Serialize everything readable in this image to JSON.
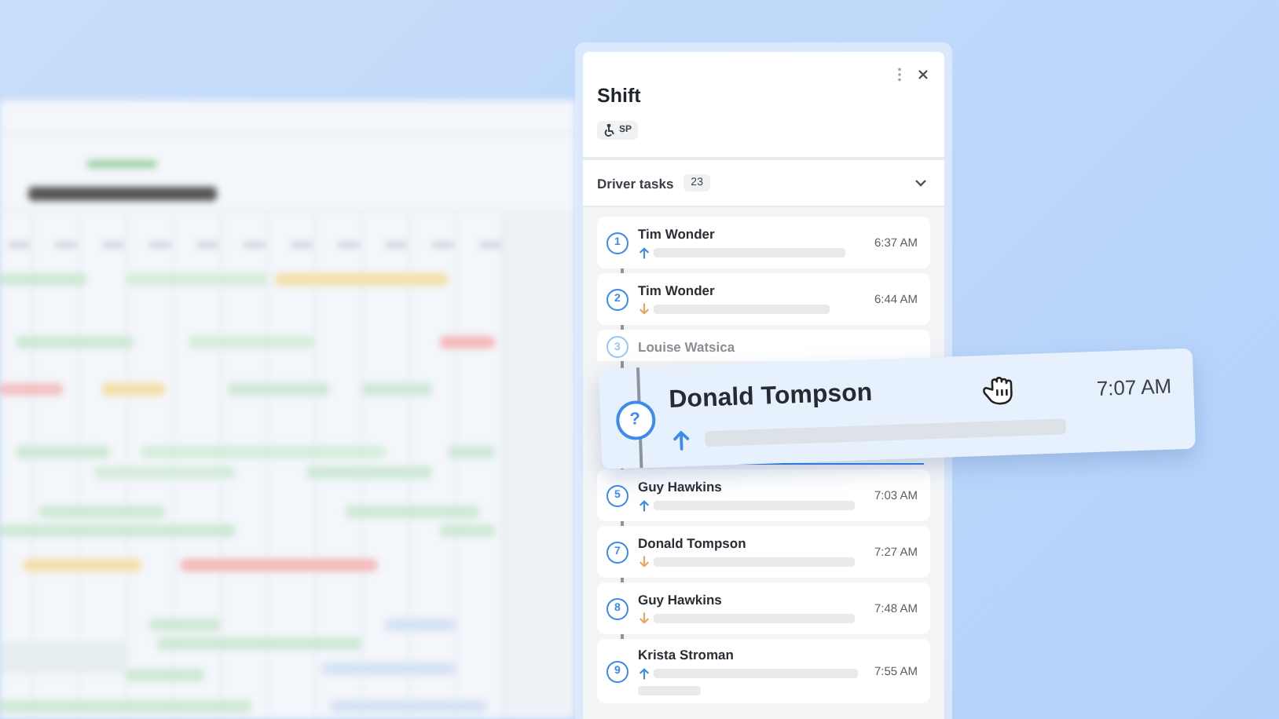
{
  "panel": {
    "title": "Shift",
    "badge": "SP"
  },
  "section": {
    "label": "Driver tasks",
    "count": "23",
    "expanded": true
  },
  "tasks": [
    {
      "number": "1",
      "name": "Tim Wonder",
      "time": "6:37 AM",
      "kind": "pickup"
    },
    {
      "number": "2",
      "name": "Tim Wonder",
      "time": "6:44 AM",
      "kind": "dropoff"
    },
    {
      "number": "3",
      "name": "Louise Watsica",
      "kind": "covered"
    },
    {
      "number": "5",
      "name": "Guy Hawkins",
      "time": "7:03 AM",
      "kind": "pickup"
    },
    {
      "number": "7",
      "name": "Donald Tompson",
      "time": "7:27 AM",
      "kind": "dropoff"
    },
    {
      "number": "8",
      "name": "Guy Hawkins",
      "time": "7:48 AM",
      "kind": "dropoff"
    },
    {
      "number": "9",
      "name": "Krista Stroman",
      "time": "7:55 AM",
      "kind": "pickup"
    }
  ],
  "dragged": {
    "number": "?",
    "name": "Donald Tompson",
    "time": "7:07 AM",
    "kind": "pickup"
  }
}
